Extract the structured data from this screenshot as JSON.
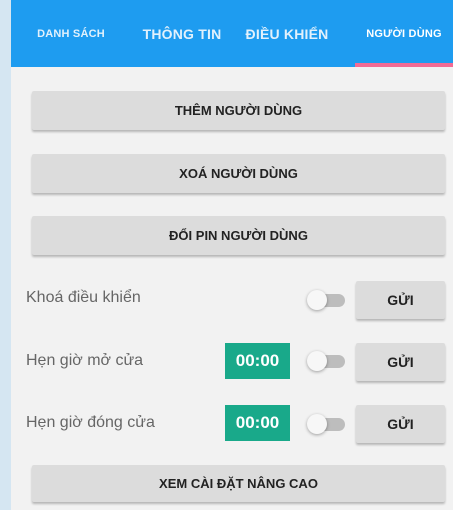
{
  "tabs": [
    {
      "label": "DANH SÁCH"
    },
    {
      "label": "THÔNG TIN"
    },
    {
      "label": "ĐIỀU KHIỂN"
    },
    {
      "label": "NGƯỜI DÙNG",
      "active": true
    }
  ],
  "actions": {
    "add_user": "THÊM NGƯỜI DÙNG",
    "delete_user": "XOÁ NGƯỜI DÙNG",
    "change_pin": "ĐỔI PIN NGƯỜI DÙNG",
    "advanced_settings": "XEM CÀI ĐẶT NÂNG CAO"
  },
  "settings": [
    {
      "label": "Khoá điều khiển",
      "enabled": false,
      "send_label": "GỬI"
    },
    {
      "label": "Hẹn giờ mở cửa",
      "time": "00:00",
      "enabled": false,
      "send_label": "GỬI"
    },
    {
      "label": "Hẹn giờ đóng cửa",
      "time": "00:00",
      "enabled": false,
      "send_label": "GỬI"
    }
  ],
  "colors": {
    "tab_bar": "#1e9cf0",
    "tab_indicator": "#f36b95",
    "time_chip": "#19a98a",
    "button": "#dcdcdc"
  }
}
